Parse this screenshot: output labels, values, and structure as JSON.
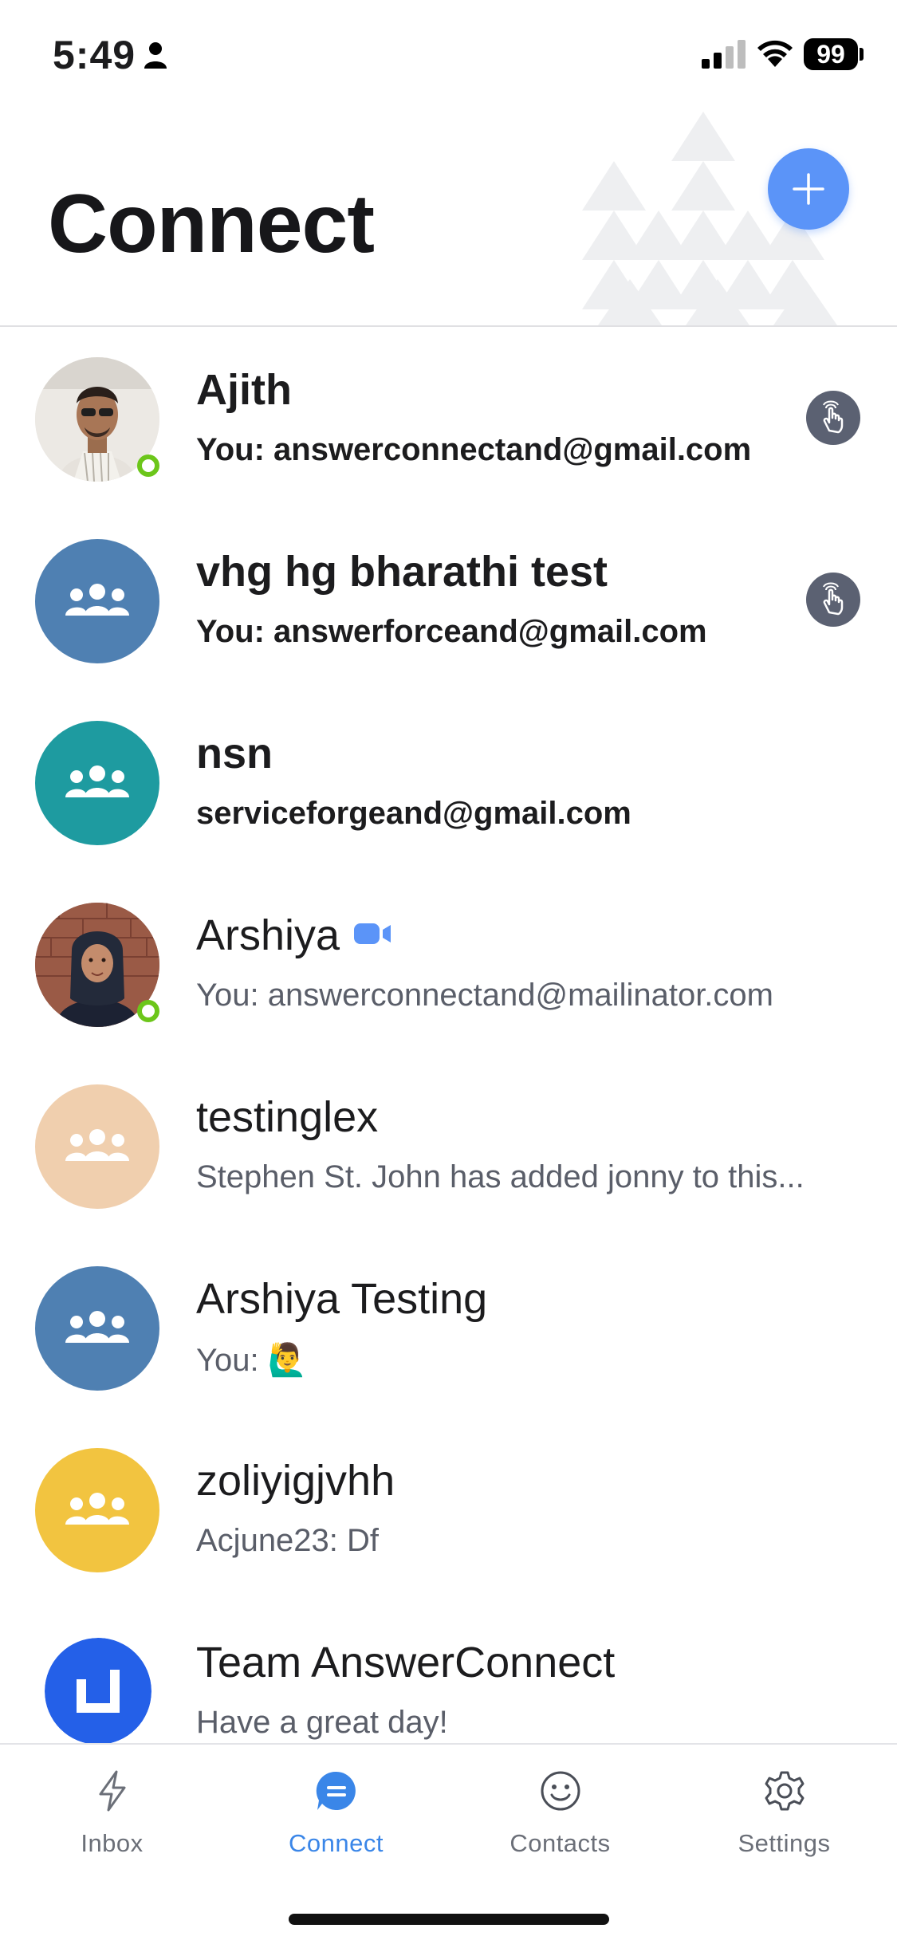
{
  "status_bar": {
    "time": "5:49",
    "battery": "99"
  },
  "header": {
    "title": "Connect"
  },
  "colors": {
    "accent": "#3a86e8",
    "fab": "#5b94f8",
    "online": "#6cc61a",
    "avatar_blue": "#4f80b2",
    "avatar_teal": "#1e9ba0",
    "avatar_peach": "#f0cfae",
    "avatar_yellow": "#f2c440",
    "avatar_brand": "#2460e8"
  },
  "conversations": [
    {
      "name": "Ajith",
      "preview": "You: answerconnectand@gmail.com",
      "unread": true,
      "online": true,
      "avatar": "photo-man",
      "nudge": true
    },
    {
      "name": "vhg hg bharathi test",
      "preview": "You: answerforceand@gmail.com",
      "unread": true,
      "avatar": "group-icon",
      "nudge": true
    },
    {
      "name": "nsn",
      "preview": "serviceforgeand@gmail.com",
      "unread": true,
      "avatar": "group-icon"
    },
    {
      "name": "Arshiya",
      "preview": "You: answerconnectand@mailinator.com",
      "online": true,
      "avatar": "photo-woman",
      "video": true
    },
    {
      "name": "testinglex",
      "preview": "Stephen St. John has added jonny to this...",
      "avatar": "group-icon"
    },
    {
      "name": "Arshiya Testing",
      "preview": "You: 🙋‍♂️",
      "avatar": "group-icon"
    },
    {
      "name": "zoliyigjvhh",
      "preview": "Acjune23: Df",
      "avatar": "group-icon"
    },
    {
      "name": "Team AnswerConnect",
      "preview": "Have a great day!",
      "avatar": "brand-logo"
    }
  ],
  "tabs": [
    {
      "label": "Inbox",
      "icon": "bolt-icon"
    },
    {
      "label": "Connect",
      "icon": "chat-bubble-icon",
      "active": true
    },
    {
      "label": "Contacts",
      "icon": "smiley-icon"
    },
    {
      "label": "Settings",
      "icon": "gear-icon"
    }
  ]
}
